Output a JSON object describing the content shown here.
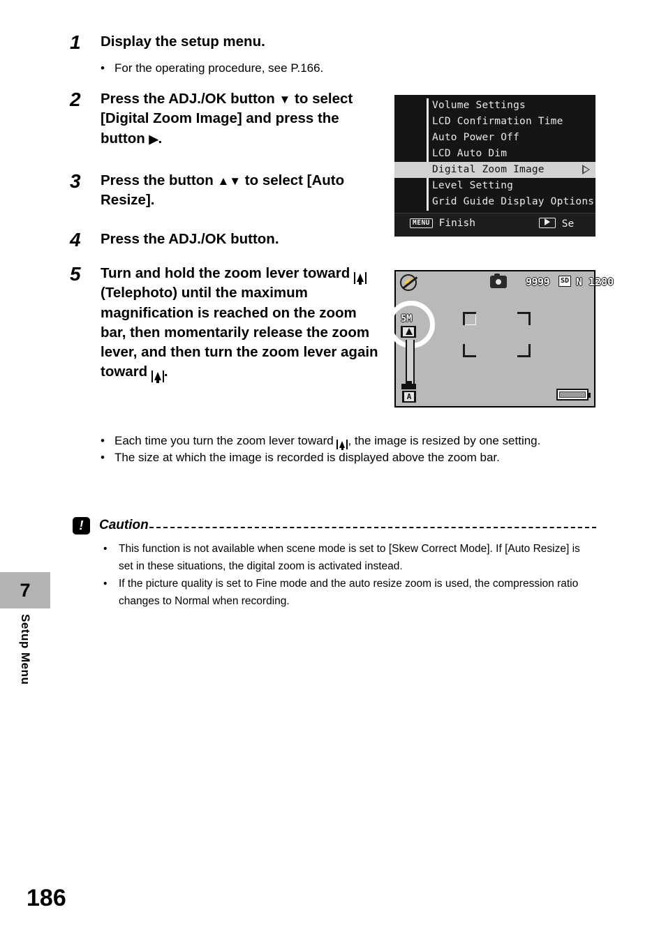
{
  "page": {
    "number": "186",
    "chapter_number": "7",
    "chapter_label": "Setup Menu"
  },
  "steps": [
    {
      "number": "1",
      "text": "Display the setup menu.",
      "bullets": [
        "For the operating procedure, see P.166."
      ]
    },
    {
      "number": "2",
      "text_a": "Press the ADJ./OK button ",
      "glyph_a": "▼",
      "text_b": " to select [Digital Zoom Image] and press the button ",
      "glyph_b": "▶",
      "text_c": "."
    },
    {
      "number": "3",
      "text_a": "Press the button ",
      "glyph_a": "▲▼",
      "text_b": " to select [Auto Resize]."
    },
    {
      "number": "4",
      "text": "Press the ADJ./OK button."
    },
    {
      "number": "5",
      "text_a": "Turn and hold the zoom lever toward ",
      "glyph_a": "tele-icon",
      "text_b": " (Telephoto) until the maximum magnification is reached on the zoom bar, then momentarily release the zoom lever, and then turn the zoom lever again toward ",
      "glyph_b": "tele-icon",
      "text_c": "."
    }
  ],
  "step5_bullets": [
    {
      "text_a": "Each time you turn the zoom lever toward ",
      "glyph": "tele-icon",
      "text_b": ", the image is resized by one setting."
    },
    {
      "text_a": "The size at which the image is recorded is displayed above the zoom bar.",
      "glyph": "",
      "text_b": ""
    }
  ],
  "caution": {
    "icon": "exclamation-icon",
    "title": "Caution",
    "rule": "-------------------------------------------------------------------------------------",
    "items": [
      "This function is not available when scene mode is set to [Skew Correct Mode]. If [Auto Resize] is set in these situations, the digital zoom is activated instead.",
      "If the picture quality is set to Fine mode and the auto resize zoom is used, the compression ratio changes to Normal when recording."
    ]
  },
  "menu_screenshot": {
    "items": [
      {
        "label": "Volume Settings",
        "selected": false
      },
      {
        "label": "LCD Confirmation Time",
        "selected": false
      },
      {
        "label": "Auto Power Off",
        "selected": false
      },
      {
        "label": "LCD Auto Dim",
        "selected": false
      },
      {
        "label": "Digital Zoom Image",
        "selected": true
      },
      {
        "label": "Level Setting",
        "selected": false
      },
      {
        "label": "Grid Guide Display Options",
        "selected": false
      }
    ],
    "footer": {
      "left_badge": "MENU",
      "left_label": "Finish",
      "right_badge": "play-icon",
      "right_label": "Se"
    }
  },
  "lcd_screenshot": {
    "flash_icon": "flash-off-icon",
    "mode_icon": "still-camera-icon",
    "shots_remaining": "9999",
    "card_badge": "SD",
    "quality_size": "N 1280",
    "zoom_size_label": "5M",
    "tele_icon": "telephoto-icon",
    "wide_icon": "A",
    "battery_icon": "battery-icon"
  },
  "colors": {
    "tab_gray": "#b3b3b3",
    "menu_bg": "#151515",
    "menu_selected_bg": "#d2d2d2",
    "lcd_bg": "#b9b9b9"
  }
}
